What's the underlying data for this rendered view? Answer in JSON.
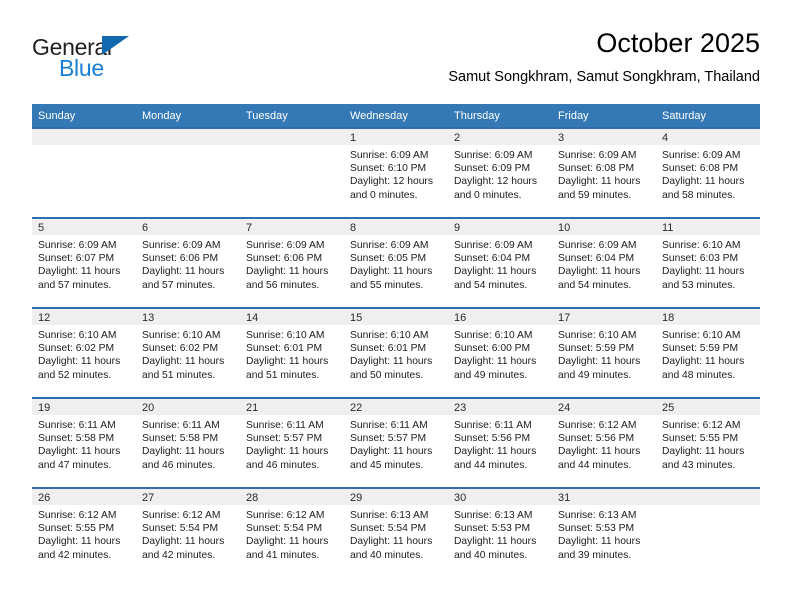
{
  "brand": {
    "name_part1": "General",
    "name_part2": "Blue"
  },
  "header": {
    "title": "October 2025",
    "subtitle": "Samut Songkhram, Samut Songkhram, Thailand"
  },
  "calendar": {
    "weekday_headers": [
      "Sunday",
      "Monday",
      "Tuesday",
      "Wednesday",
      "Thursday",
      "Friday",
      "Saturday"
    ],
    "labels": {
      "sunrise_prefix": "Sunrise:",
      "sunset_prefix": "Sunset:",
      "daylight_prefix": "Daylight:"
    },
    "weeks": [
      [
        {
          "day": "",
          "empty": true
        },
        {
          "day": "",
          "empty": true
        },
        {
          "day": "",
          "empty": true
        },
        {
          "day": "1",
          "sunrise": "Sunrise: 6:09 AM",
          "sunset": "Sunset: 6:10 PM",
          "daylight_line1": "Daylight: 12 hours",
          "daylight_line2": "and 0 minutes."
        },
        {
          "day": "2",
          "sunrise": "Sunrise: 6:09 AM",
          "sunset": "Sunset: 6:09 PM",
          "daylight_line1": "Daylight: 12 hours",
          "daylight_line2": "and 0 minutes."
        },
        {
          "day": "3",
          "sunrise": "Sunrise: 6:09 AM",
          "sunset": "Sunset: 6:08 PM",
          "daylight_line1": "Daylight: 11 hours",
          "daylight_line2": "and 59 minutes."
        },
        {
          "day": "4",
          "sunrise": "Sunrise: 6:09 AM",
          "sunset": "Sunset: 6:08 PM",
          "daylight_line1": "Daylight: 11 hours",
          "daylight_line2": "and 58 minutes."
        }
      ],
      [
        {
          "day": "5",
          "sunrise": "Sunrise: 6:09 AM",
          "sunset": "Sunset: 6:07 PM",
          "daylight_line1": "Daylight: 11 hours",
          "daylight_line2": "and 57 minutes."
        },
        {
          "day": "6",
          "sunrise": "Sunrise: 6:09 AM",
          "sunset": "Sunset: 6:06 PM",
          "daylight_line1": "Daylight: 11 hours",
          "daylight_line2": "and 57 minutes."
        },
        {
          "day": "7",
          "sunrise": "Sunrise: 6:09 AM",
          "sunset": "Sunset: 6:06 PM",
          "daylight_line1": "Daylight: 11 hours",
          "daylight_line2": "and 56 minutes."
        },
        {
          "day": "8",
          "sunrise": "Sunrise: 6:09 AM",
          "sunset": "Sunset: 6:05 PM",
          "daylight_line1": "Daylight: 11 hours",
          "daylight_line2": "and 55 minutes."
        },
        {
          "day": "9",
          "sunrise": "Sunrise: 6:09 AM",
          "sunset": "Sunset: 6:04 PM",
          "daylight_line1": "Daylight: 11 hours",
          "daylight_line2": "and 54 minutes."
        },
        {
          "day": "10",
          "sunrise": "Sunrise: 6:09 AM",
          "sunset": "Sunset: 6:04 PM",
          "daylight_line1": "Daylight: 11 hours",
          "daylight_line2": "and 54 minutes."
        },
        {
          "day": "11",
          "sunrise": "Sunrise: 6:10 AM",
          "sunset": "Sunset: 6:03 PM",
          "daylight_line1": "Daylight: 11 hours",
          "daylight_line2": "and 53 minutes."
        }
      ],
      [
        {
          "day": "12",
          "sunrise": "Sunrise: 6:10 AM",
          "sunset": "Sunset: 6:02 PM",
          "daylight_line1": "Daylight: 11 hours",
          "daylight_line2": "and 52 minutes."
        },
        {
          "day": "13",
          "sunrise": "Sunrise: 6:10 AM",
          "sunset": "Sunset: 6:02 PM",
          "daylight_line1": "Daylight: 11 hours",
          "daylight_line2": "and 51 minutes."
        },
        {
          "day": "14",
          "sunrise": "Sunrise: 6:10 AM",
          "sunset": "Sunset: 6:01 PM",
          "daylight_line1": "Daylight: 11 hours",
          "daylight_line2": "and 51 minutes."
        },
        {
          "day": "15",
          "sunrise": "Sunrise: 6:10 AM",
          "sunset": "Sunset: 6:01 PM",
          "daylight_line1": "Daylight: 11 hours",
          "daylight_line2": "and 50 minutes."
        },
        {
          "day": "16",
          "sunrise": "Sunrise: 6:10 AM",
          "sunset": "Sunset: 6:00 PM",
          "daylight_line1": "Daylight: 11 hours",
          "daylight_line2": "and 49 minutes."
        },
        {
          "day": "17",
          "sunrise": "Sunrise: 6:10 AM",
          "sunset": "Sunset: 5:59 PM",
          "daylight_line1": "Daylight: 11 hours",
          "daylight_line2": "and 49 minutes."
        },
        {
          "day": "18",
          "sunrise": "Sunrise: 6:10 AM",
          "sunset": "Sunset: 5:59 PM",
          "daylight_line1": "Daylight: 11 hours",
          "daylight_line2": "and 48 minutes."
        }
      ],
      [
        {
          "day": "19",
          "sunrise": "Sunrise: 6:11 AM",
          "sunset": "Sunset: 5:58 PM",
          "daylight_line1": "Daylight: 11 hours",
          "daylight_line2": "and 47 minutes."
        },
        {
          "day": "20",
          "sunrise": "Sunrise: 6:11 AM",
          "sunset": "Sunset: 5:58 PM",
          "daylight_line1": "Daylight: 11 hours",
          "daylight_line2": "and 46 minutes."
        },
        {
          "day": "21",
          "sunrise": "Sunrise: 6:11 AM",
          "sunset": "Sunset: 5:57 PM",
          "daylight_line1": "Daylight: 11 hours",
          "daylight_line2": "and 46 minutes."
        },
        {
          "day": "22",
          "sunrise": "Sunrise: 6:11 AM",
          "sunset": "Sunset: 5:57 PM",
          "daylight_line1": "Daylight: 11 hours",
          "daylight_line2": "and 45 minutes."
        },
        {
          "day": "23",
          "sunrise": "Sunrise: 6:11 AM",
          "sunset": "Sunset: 5:56 PM",
          "daylight_line1": "Daylight: 11 hours",
          "daylight_line2": "and 44 minutes."
        },
        {
          "day": "24",
          "sunrise": "Sunrise: 6:12 AM",
          "sunset": "Sunset: 5:56 PM",
          "daylight_line1": "Daylight: 11 hours",
          "daylight_line2": "and 44 minutes."
        },
        {
          "day": "25",
          "sunrise": "Sunrise: 6:12 AM",
          "sunset": "Sunset: 5:55 PM",
          "daylight_line1": "Daylight: 11 hours",
          "daylight_line2": "and 43 minutes."
        }
      ],
      [
        {
          "day": "26",
          "sunrise": "Sunrise: 6:12 AM",
          "sunset": "Sunset: 5:55 PM",
          "daylight_line1": "Daylight: 11 hours",
          "daylight_line2": "and 42 minutes."
        },
        {
          "day": "27",
          "sunrise": "Sunrise: 6:12 AM",
          "sunset": "Sunset: 5:54 PM",
          "daylight_line1": "Daylight: 11 hours",
          "daylight_line2": "and 42 minutes."
        },
        {
          "day": "28",
          "sunrise": "Sunrise: 6:12 AM",
          "sunset": "Sunset: 5:54 PM",
          "daylight_line1": "Daylight: 11 hours",
          "daylight_line2": "and 41 minutes."
        },
        {
          "day": "29",
          "sunrise": "Sunrise: 6:13 AM",
          "sunset": "Sunset: 5:54 PM",
          "daylight_line1": "Daylight: 11 hours",
          "daylight_line2": "and 40 minutes."
        },
        {
          "day": "30",
          "sunrise": "Sunrise: 6:13 AM",
          "sunset": "Sunset: 5:53 PM",
          "daylight_line1": "Daylight: 11 hours",
          "daylight_line2": "and 40 minutes."
        },
        {
          "day": "31",
          "sunrise": "Sunrise: 6:13 AM",
          "sunset": "Sunset: 5:53 PM",
          "daylight_line1": "Daylight: 11 hours",
          "daylight_line2": "and 39 minutes."
        },
        {
          "day": "",
          "empty": true
        }
      ]
    ]
  },
  "colors": {
    "header_blue": "#3479b5",
    "row_divider_blue": "#2f6fad",
    "day_band_gray": "#efefef",
    "brand_blue": "#1a7fd4",
    "brand_dark": "#231f20"
  }
}
